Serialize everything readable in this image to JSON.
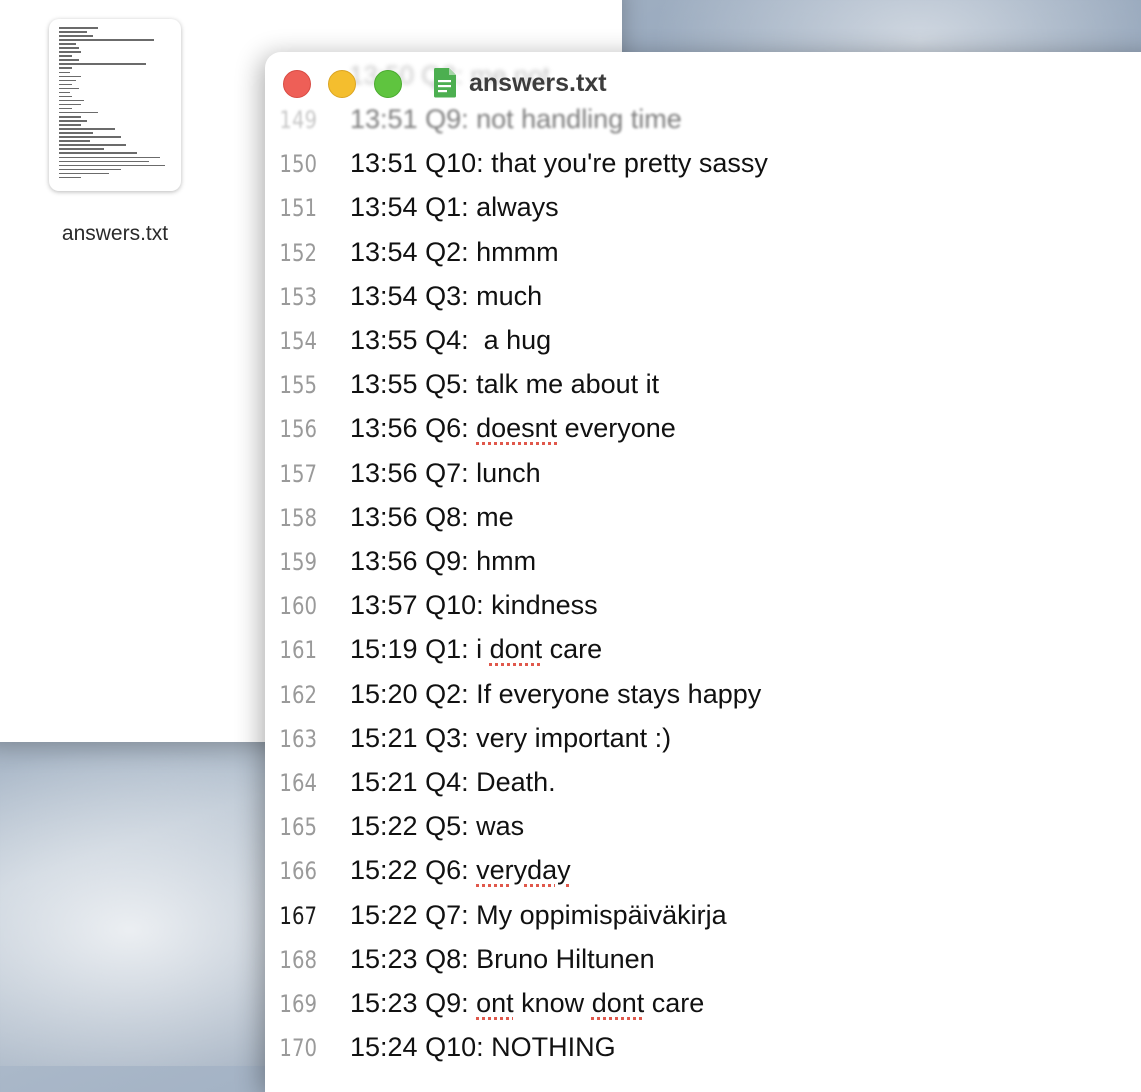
{
  "back_window": {
    "file_icon": {
      "name": "answers.txt",
      "thumb_line_count": 38
    }
  },
  "editor_window": {
    "title": "answers.txt",
    "title_ghost": "13:50 Q8: me not",
    "traffic_lights": {
      "close_color": "#ee5f57",
      "minimize_color": "#f4be2e",
      "maximize_color": "#5fc43f"
    },
    "doc_icon_color": "#4caf50",
    "lines": [
      {
        "num": "149",
        "segments": [
          {
            "t": "13:51 Q9: not handling time"
          }
        ],
        "faded": true
      },
      {
        "num": "150",
        "segments": [
          {
            "t": "13:51 Q10: that you're pretty sassy"
          }
        ]
      },
      {
        "num": "151",
        "segments": [
          {
            "t": "13:54 Q1: always"
          }
        ]
      },
      {
        "num": "152",
        "segments": [
          {
            "t": "13:54 Q2: hmmm"
          }
        ]
      },
      {
        "num": "153",
        "segments": [
          {
            "t": "13:54 Q3: much"
          }
        ]
      },
      {
        "num": "154",
        "segments": [
          {
            "t": "13:55 Q4:  a hug"
          }
        ]
      },
      {
        "num": "155",
        "segments": [
          {
            "t": "13:55 Q5: talk me about it"
          }
        ]
      },
      {
        "num": "156",
        "segments": [
          {
            "t": "13:56 Q6: "
          },
          {
            "t": "doesnt",
            "m": true
          },
          {
            "t": " everyone"
          }
        ]
      },
      {
        "num": "157",
        "segments": [
          {
            "t": "13:56 Q7: lunch"
          }
        ]
      },
      {
        "num": "158",
        "segments": [
          {
            "t": "13:56 Q8: me"
          }
        ]
      },
      {
        "num": "159",
        "segments": [
          {
            "t": "13:56 Q9: hmm"
          }
        ]
      },
      {
        "num": "160",
        "segments": [
          {
            "t": "13:57 Q10: kindness"
          }
        ]
      },
      {
        "num": "161",
        "segments": [
          {
            "t": "15:19 Q1: i "
          },
          {
            "t": "dont",
            "m": true
          },
          {
            "t": " care"
          }
        ]
      },
      {
        "num": "162",
        "segments": [
          {
            "t": "15:20 Q2: If everyone stays happy"
          }
        ]
      },
      {
        "num": "163",
        "segments": [
          {
            "t": "15:21 Q3: very important :)"
          }
        ]
      },
      {
        "num": "164",
        "segments": [
          {
            "t": "15:21 Q4: Death."
          }
        ]
      },
      {
        "num": "165",
        "segments": [
          {
            "t": "15:22 Q5: was"
          }
        ]
      },
      {
        "num": "166",
        "segments": [
          {
            "t": "15:22 Q6: "
          },
          {
            "t": "veryday",
            "m": true
          }
        ]
      },
      {
        "num": "167",
        "segments": [
          {
            "t": "15:22 Q7: My oppimispäiväkirja"
          }
        ],
        "current": true
      },
      {
        "num": "168",
        "segments": [
          {
            "t": "15:23 Q8: Bruno Hiltunen"
          }
        ]
      },
      {
        "num": "169",
        "segments": [
          {
            "t": "15:23 Q9: "
          },
          {
            "t": "ont",
            "m": true
          },
          {
            "t": " know "
          },
          {
            "t": "dont",
            "m": true
          },
          {
            "t": " care"
          }
        ]
      },
      {
        "num": "170",
        "segments": [
          {
            "t": "15:24 Q10: NOTHING"
          }
        ]
      }
    ]
  }
}
